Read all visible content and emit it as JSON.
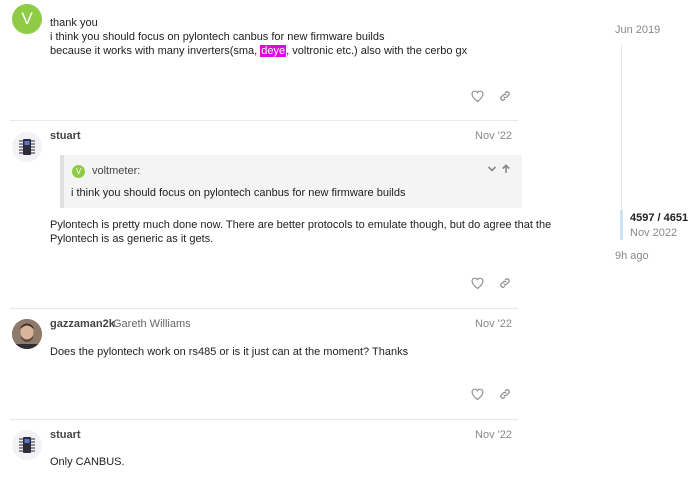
{
  "posts": [
    {
      "avatar_letter": "V",
      "avatar_color": "#8fcc45",
      "lines": [
        "thank you",
        "i think you should focus on pylontech canbus for new firmware builds"
      ],
      "line3_before": "because it works with many inverters(sma, ",
      "line3_highlight": "deye",
      "line3_after": ", voltronic etc.) also with the cerbo gx"
    },
    {
      "username": "stuart",
      "date": "Nov '22",
      "quote": {
        "avatar_letter": "V",
        "username": "voltmeter:",
        "text": "i think you should focus on pylontech canbus for new firmware builds"
      },
      "lines": [
        "Pylontech is pretty much done now. There are better protocols to emulate though, but do agree that the",
        "Pylontech is as generic as it gets."
      ]
    },
    {
      "username": "gazzaman2k",
      "full_name": "Gareth Williams",
      "date": "Nov '22",
      "lines": [
        "Does the pylontech work on rs485 or is it just can at the moment? Thanks"
      ]
    },
    {
      "username": "stuart",
      "date": "Nov '22",
      "lines": [
        "Only CANBUS."
      ]
    }
  ],
  "timeline": {
    "start_date": "Jun 2019",
    "position": "4597 / 4651",
    "current_date": "Nov 2022",
    "end_label": "9h ago"
  },
  "colors": {
    "highlight": "#e600e6",
    "timeline_handle": "#cfe3f4",
    "divider": "#e9e9e9"
  },
  "icons": {
    "like": "heart-icon",
    "share": "link-icon",
    "expand": "chevron-down-icon",
    "jump": "arrow-up-icon"
  }
}
